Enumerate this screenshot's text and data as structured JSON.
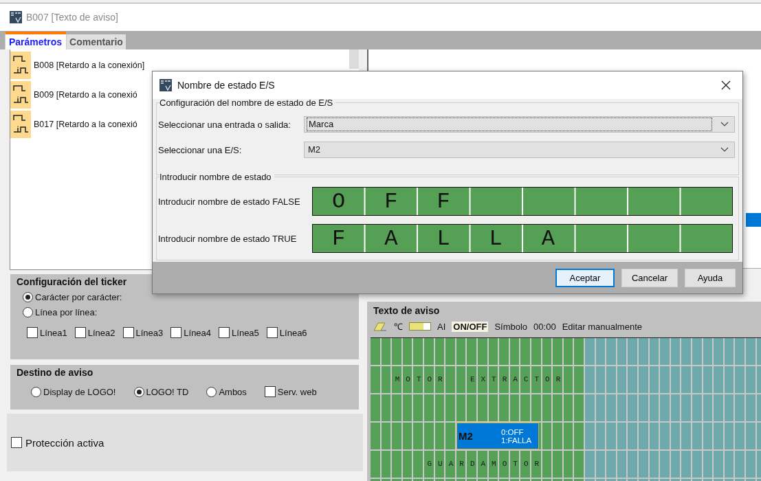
{
  "window": {
    "title": "B007 [Texto de aviso]"
  },
  "tabs": [
    {
      "label": "Parámetros",
      "selected": true
    },
    {
      "label": "Comentario",
      "selected": false
    }
  ],
  "blocks": [
    {
      "label": "B008 [Retardo a la conexión]"
    },
    {
      "label": "B009 [Retardo a la conexió"
    },
    {
      "label": "B017 [Retardo a la conexió"
    }
  ],
  "ticker": {
    "title": "Configuración del ticker",
    "options": [
      {
        "kind": "radio",
        "label": "Carácter por carácter:",
        "selected": true
      },
      {
        "kind": "radio",
        "label": "Línea por línea:",
        "selected": false
      }
    ],
    "lines": [
      {
        "label": "Línea1",
        "checked": false
      },
      {
        "label": "Línea2",
        "checked": false
      },
      {
        "label": "Línea3",
        "checked": false
      },
      {
        "label": "Línea4",
        "checked": false
      },
      {
        "label": "Línea5",
        "checked": false
      },
      {
        "label": "Línea6",
        "checked": false
      }
    ]
  },
  "destination": {
    "title": "Destino de aviso",
    "options": [
      {
        "kind": "radio",
        "label": "Display de LOGO!",
        "selected": false
      },
      {
        "kind": "radio",
        "label": "LOGO! TD",
        "selected": true
      },
      {
        "kind": "radio",
        "label": "Ambos",
        "selected": false
      },
      {
        "kind": "checkbox",
        "label": "Serv. web",
        "checked": false
      }
    ]
  },
  "protection": {
    "label": "Protección activa",
    "checked": false
  },
  "message_text": {
    "title": "Texto de aviso",
    "toolbar": [
      {
        "kind": "eraser"
      },
      {
        "kind": "label",
        "label": "℃"
      },
      {
        "kind": "bar"
      },
      {
        "kind": "label",
        "label": "AI"
      },
      {
        "kind": "highlight",
        "label": "ON/OFF"
      },
      {
        "kind": "label",
        "label": "Símbolo"
      },
      {
        "kind": "label",
        "label": "00:00"
      },
      {
        "kind": "label",
        "label": "Editar manualmente"
      }
    ],
    "rows": [
      {},
      {
        "text": "  MOTOR  EXTRACTOR"
      },
      {},
      {
        "field": {
          "name": "M2",
          "false_text": "0:OFF",
          "true_text": "1:FALLA"
        }
      },
      {
        "text": "     GUARDAMOTOR"
      }
    ]
  },
  "dialog": {
    "title": "Nombre de estado E/S",
    "config": {
      "title": "Configuración del nombre de estado de E/S",
      "selects": [
        {
          "label": "Seleccionar una entrada o salida:",
          "value": "Marca",
          "focused": true
        },
        {
          "label": "Seleccionar una E/S:",
          "value": "M2",
          "focused": false
        }
      ]
    },
    "names": {
      "title": "Introducir nombre de estado",
      "fields": [
        {
          "label": "Introducir nombre de estado FALSE",
          "value": "OFF"
        },
        {
          "label": "Introducir nombre de estado TRUE",
          "value": "FALLA"
        }
      ]
    },
    "buttons": [
      {
        "label": "Aceptar",
        "default": true
      },
      {
        "label": "Cancelar",
        "default": false
      },
      {
        "label": "Ayuda",
        "default": false
      }
    ]
  }
}
